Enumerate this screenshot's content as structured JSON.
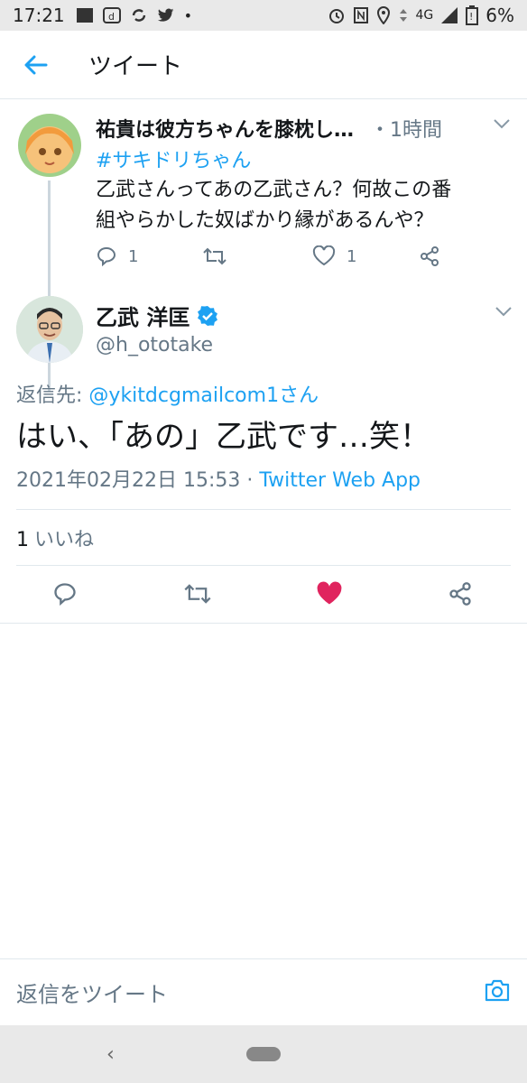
{
  "status_bar": {
    "time": "17:21",
    "network": "4G",
    "battery": "6%"
  },
  "app_bar": {
    "title": "ツイート"
  },
  "parent_tweet": {
    "name": "祐貴は彼方ちゃんを膝枕し…",
    "time": "・1時間",
    "hashtag": "#サキドリちゃん",
    "text_line1": "乙武さんってあの乙武さん？何故この番",
    "text_line2": "組やらかした奴ばかり縁があるんや？",
    "reply_count": "1",
    "retweet_count": "",
    "like_count": "1"
  },
  "main_tweet": {
    "name": "乙武 洋匡",
    "handle": "@h_ototake",
    "reply_label": "返信先:",
    "reply_mention": "@ykitdcgmailcom1さん",
    "text": "はい、「あの」乙武です…笑！",
    "timestamp": "2021年02月22日 15:53",
    "separator": " · ",
    "source": "Twitter Web App",
    "like_count": "1",
    "like_label": "いいね"
  },
  "reply_bar": {
    "placeholder": "返信をツイート"
  },
  "colors": {
    "accent": "#1da1f2",
    "like": "#e0245e",
    "muted": "#657786",
    "text": "#14171a"
  }
}
